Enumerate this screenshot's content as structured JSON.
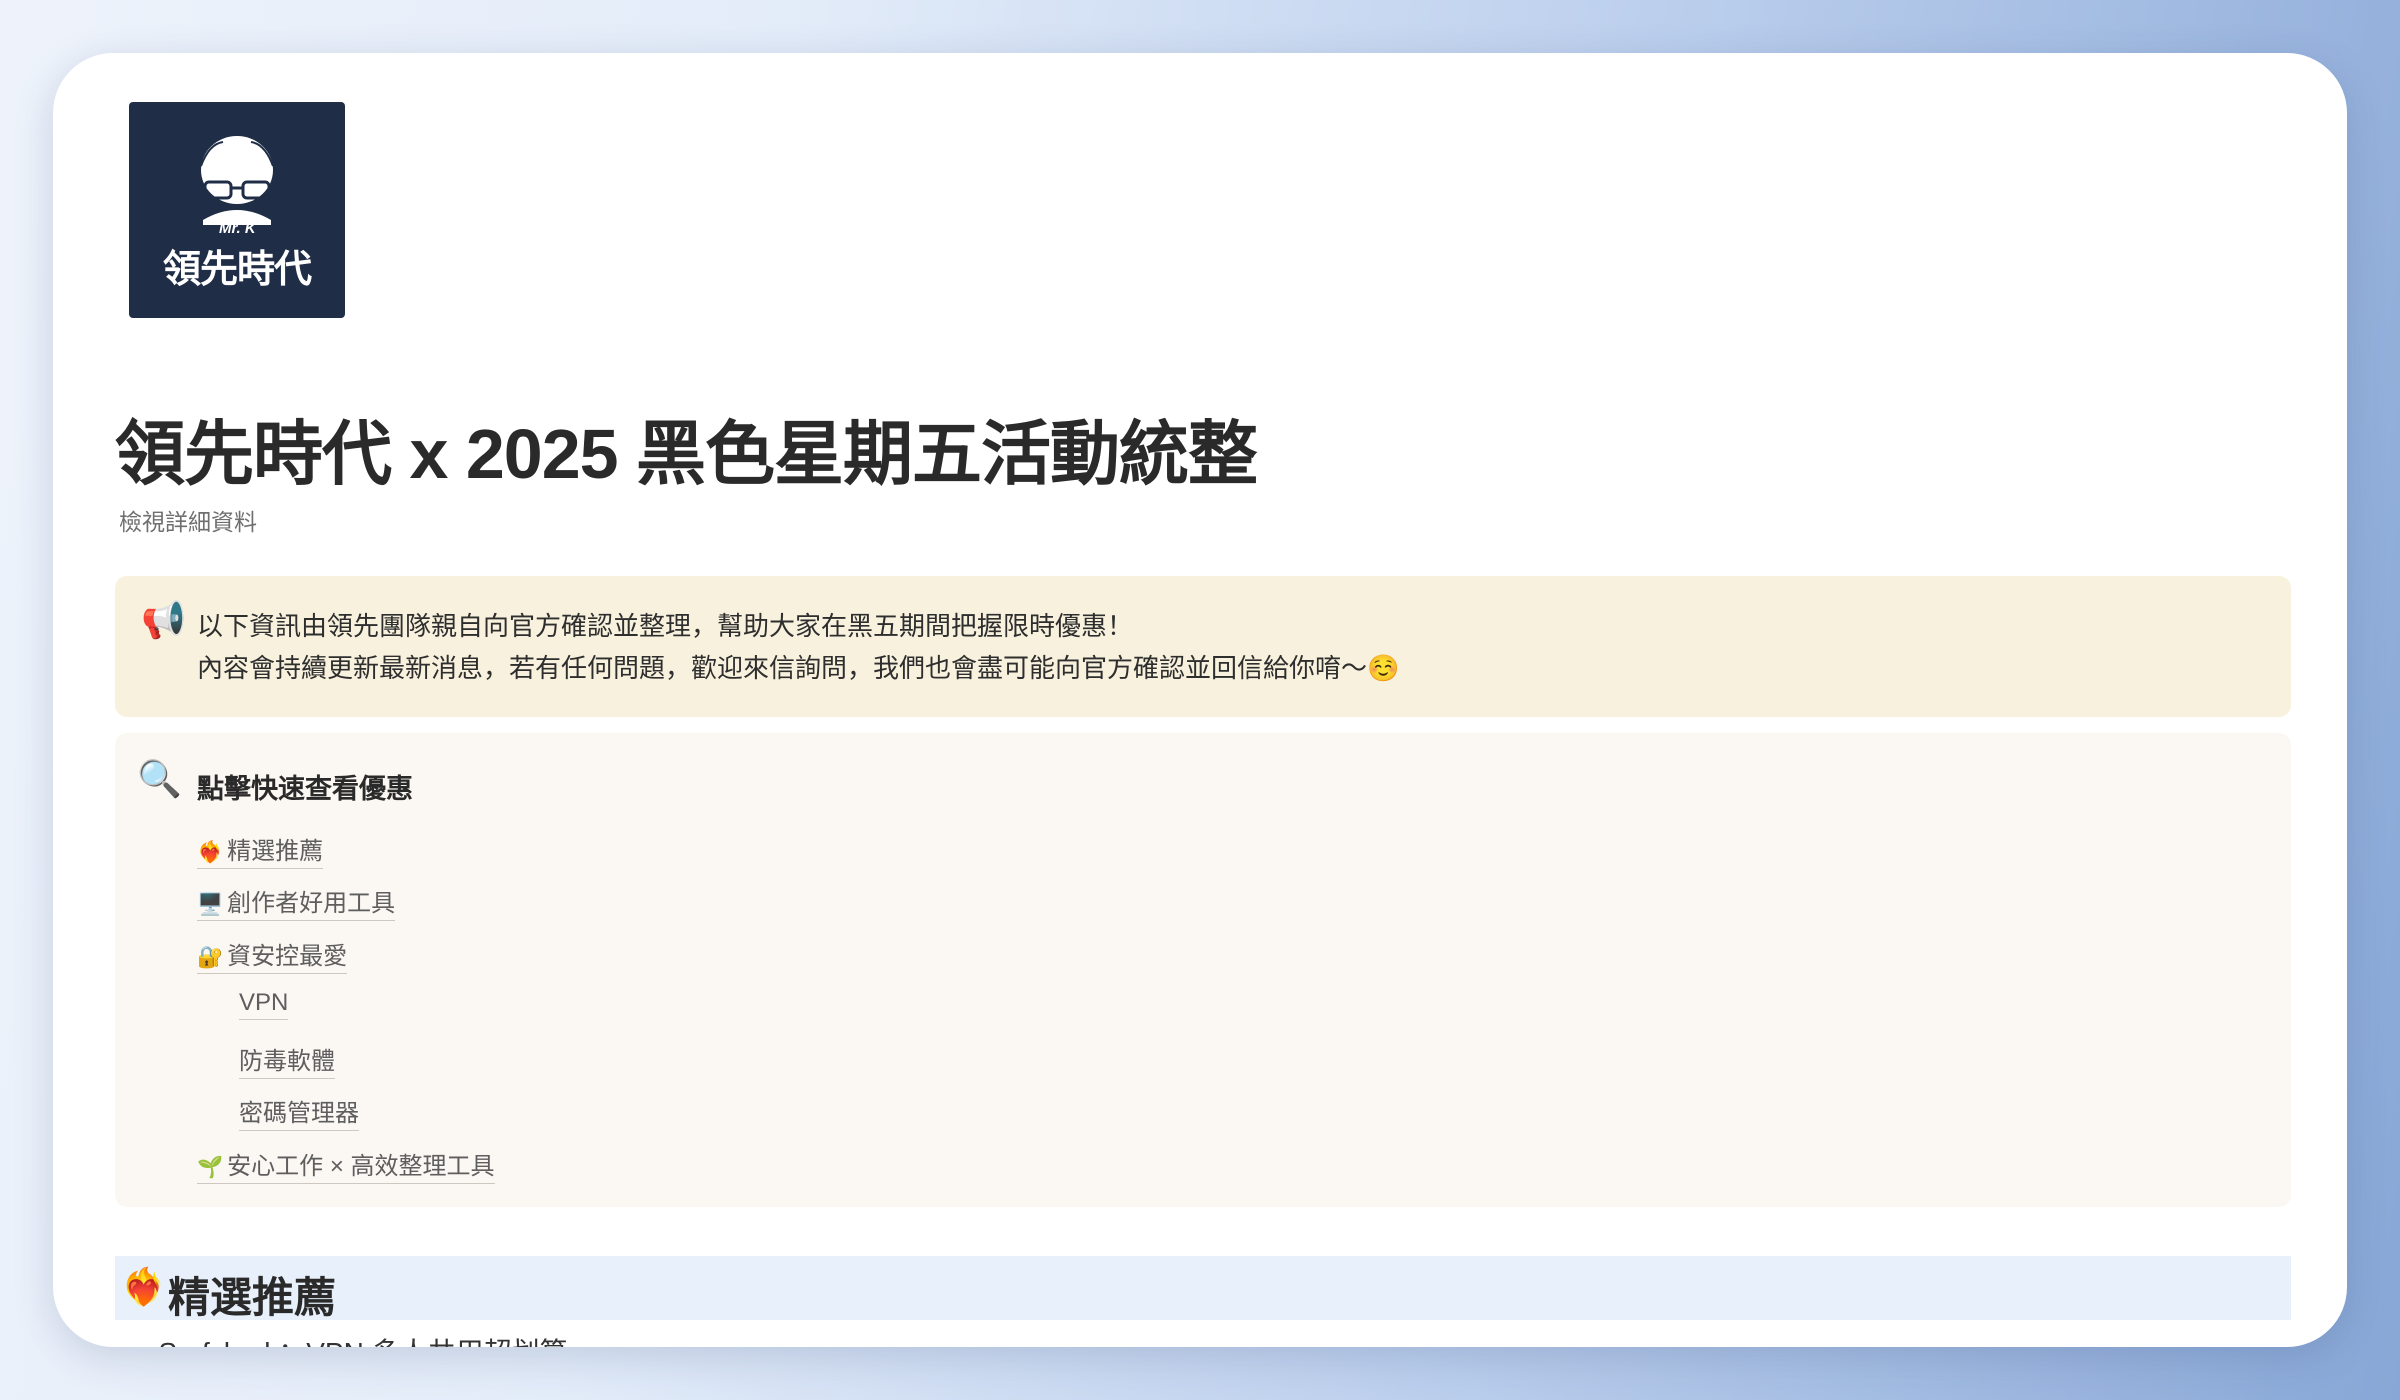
{
  "logo": {
    "small_text": "Mr. K",
    "brand_text": "領先時代",
    "bg_color": "#1f2d47"
  },
  "page": {
    "title": "領先時代 x 2025 黑色星期五活動統整",
    "subtitle": "檢視詳細資料"
  },
  "notice": {
    "icon": "📢",
    "line1": "以下資訊由領先團隊親自向官方確認並整理，幫助大家在黑五期間把握限時優惠！",
    "line2": "內容會持續更新最新消息，若有任何問題，歡迎來信詢問，我們也會盡可能向官方確認並回信給你唷～☺️",
    "bg_color": "#f8f1de"
  },
  "toc": {
    "icon": "🔍",
    "heading": "點擊快速查看優惠",
    "items": [
      {
        "emoji": "❤️‍🔥",
        "label": "精選推薦"
      },
      {
        "emoji": "🖥️",
        "label": "創作者好用工具"
      },
      {
        "emoji": "🔐",
        "label": "資安控最愛"
      },
      {
        "emoji": "",
        "label": "VPN"
      },
      {
        "emoji": "",
        "label": "防毒軟體"
      },
      {
        "emoji": "",
        "label": "密碼管理器"
      },
      {
        "emoji": "🌱",
        "label": "安心工作 × 高效整理工具"
      }
    ],
    "bg_color": "#fbf7f3"
  },
  "section": {
    "emoji": "❤️‍🔥",
    "title": "精選推薦",
    "bg_color": "#e7f0fb"
  },
  "peek_item": {
    "label": "Surfshark：VPN 多人共用超划算"
  }
}
